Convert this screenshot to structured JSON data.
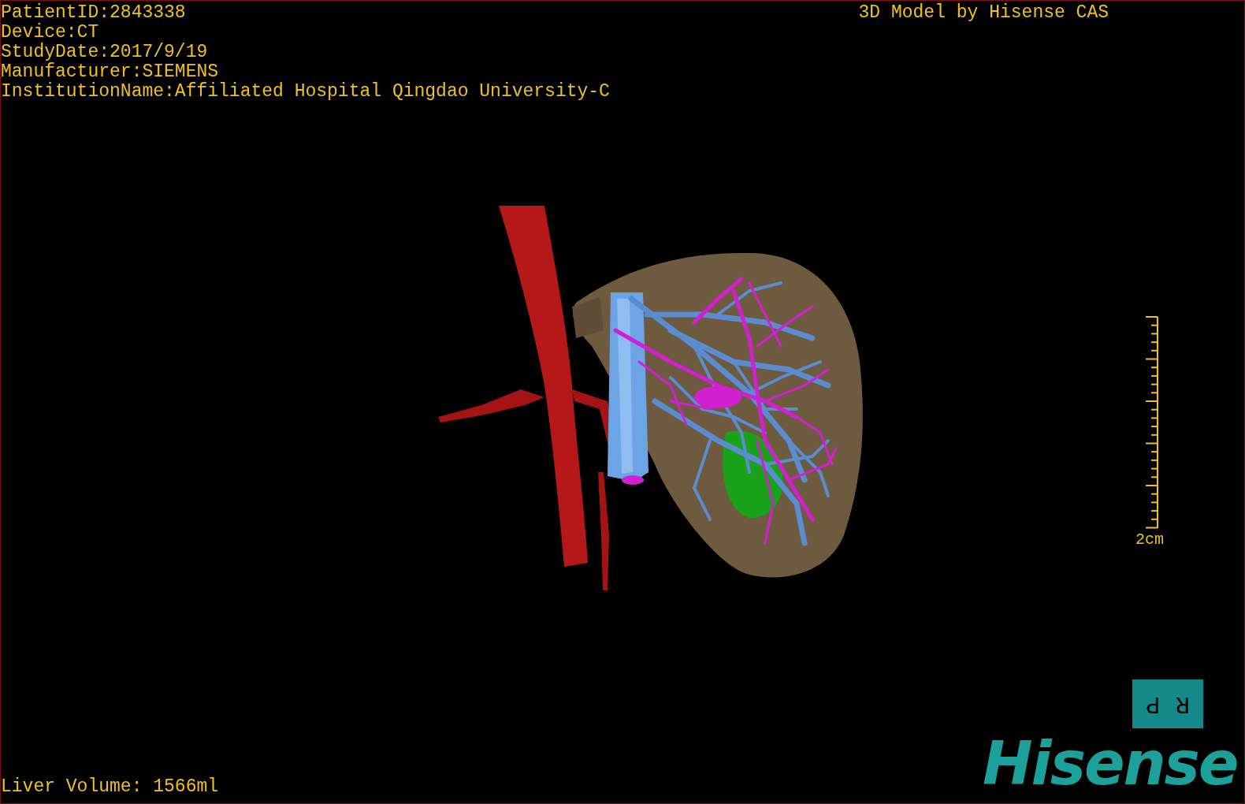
{
  "study_info": [
    "PatientID:2843338",
    "Device:CT",
    "StudyDate:2017/9/19",
    "Manufacturer:SIEMENS",
    "InstitutionName:Affiliated Hospital Qingdao University-C"
  ],
  "model_credit": "3D Model by Hisense CAS",
  "scale_bar": {
    "label": "2cm"
  },
  "orientation": [
    "P",
    "R"
  ],
  "liver_volume": "Liver Volume: 1566ml",
  "logo": "Hisense"
}
